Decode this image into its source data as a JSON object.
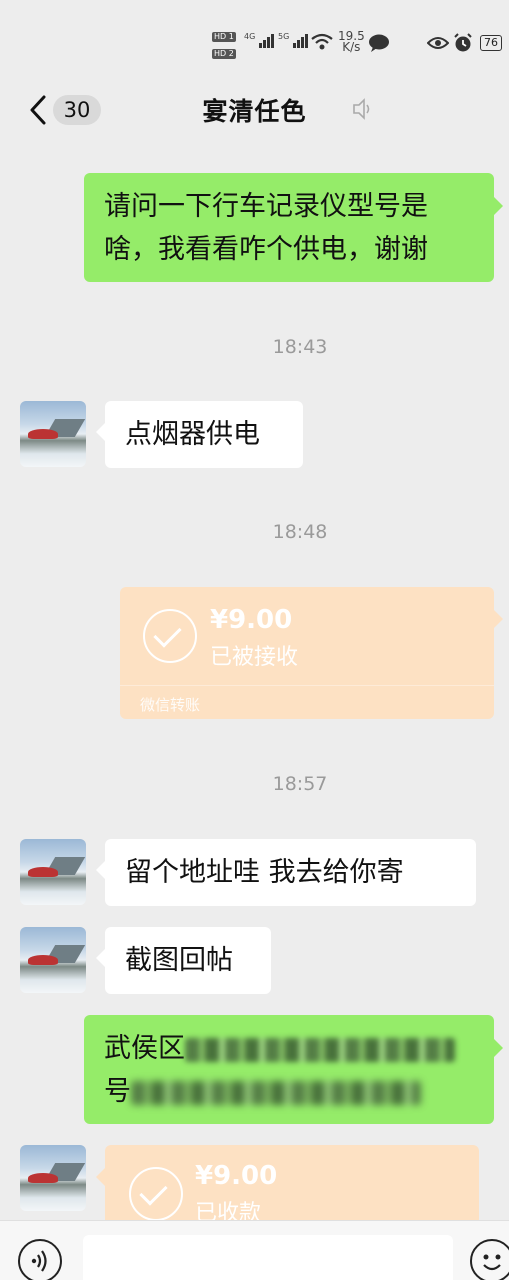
{
  "status_bar": {
    "hd1": "HD 1",
    "hd2": "HD 2",
    "net1": "4G",
    "net2": "5G",
    "speed_value": "19.5",
    "speed_unit": "K/s",
    "battery": "76"
  },
  "header": {
    "unread_count": "30",
    "title": "宴清任色"
  },
  "messages": {
    "m1_line1": "请问一下行车记录仪型号是",
    "m1_line2": "啥，我看看咋个供电，谢谢",
    "t1": "18:43",
    "m2": "点烟器供电",
    "t2": "18:48",
    "transfer1_amount": "¥9.00",
    "transfer1_status": "已被接收",
    "transfer1_footer": "微信转账",
    "t3": "18:57",
    "m3": "留个地址哇 我去给你寄",
    "m4": "截图回帖",
    "m5_prefix": "武侯区",
    "m5_line2_prefix": "号",
    "transfer2_amount": "¥9.00",
    "transfer2_status": "已收款"
  },
  "colors": {
    "sent_bubble": "#95ec69",
    "received_bubble": "#ffffff",
    "transfer_card": "#fde1c3",
    "background": "#ededed"
  },
  "icons": [
    "back-arrow-icon",
    "mute-icon",
    "voice-icon",
    "emoji-icon",
    "check-circle-icon",
    "wechat-icon",
    "eye-icon",
    "alarm-icon",
    "wifi-icon"
  ]
}
